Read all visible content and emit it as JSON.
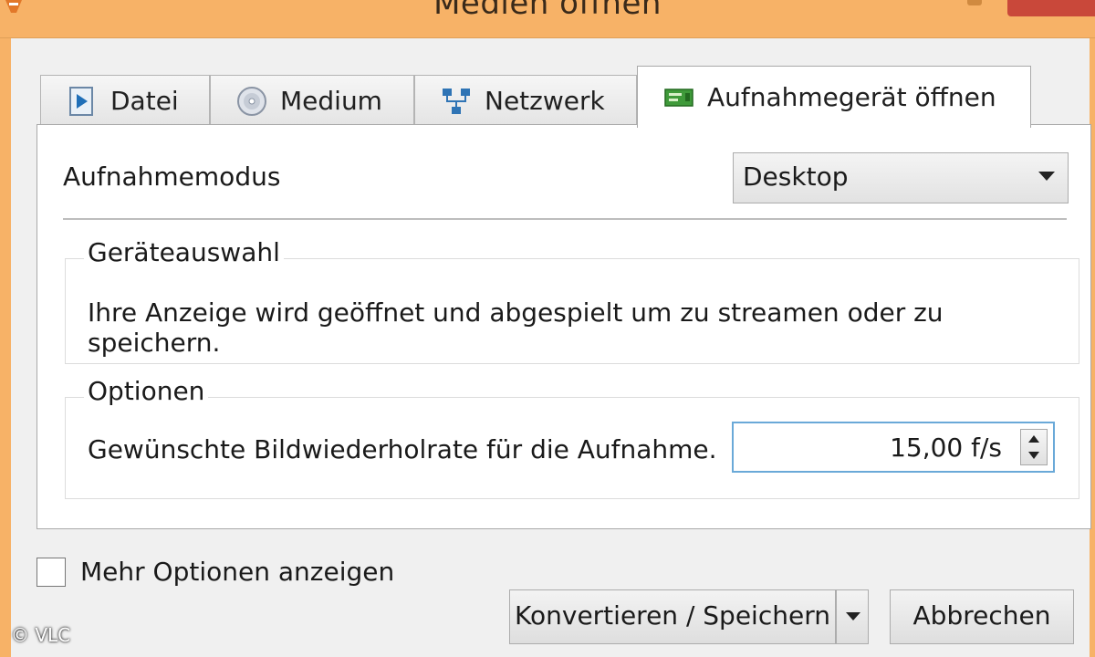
{
  "window": {
    "title": "Medien öffnen"
  },
  "tabs": [
    {
      "label": "Datei",
      "icon": "play-file-icon"
    },
    {
      "label": "Medium",
      "icon": "disc-icon"
    },
    {
      "label": "Netzwerk",
      "icon": "network-icon"
    },
    {
      "label": "Aufnahmegerät öffnen",
      "icon": "capture-card-icon",
      "active": true
    }
  ],
  "capture": {
    "mode_label": "Aufnahmemodus",
    "mode_value": "Desktop"
  },
  "device_group": {
    "legend": "Geräteauswahl",
    "description": "Ihre Anzeige wird geöffnet und abgespielt um zu streamen oder zu speichern."
  },
  "options_group": {
    "legend": "Optionen",
    "framerate_label": "Gewünschte Bildwiederholrate für die Aufnahme.",
    "framerate_value": "15,00 f/s"
  },
  "footer": {
    "more_options_label": "Mehr Optionen anzeigen",
    "more_options_checked": false,
    "convert_label": "Konvertieren / Speichern",
    "cancel_label": "Abbrechen"
  },
  "copyright": "© VLC",
  "colors": {
    "titlebar": "#f7b267",
    "close": "#c9483a",
    "focus": "#6aa9d8"
  }
}
